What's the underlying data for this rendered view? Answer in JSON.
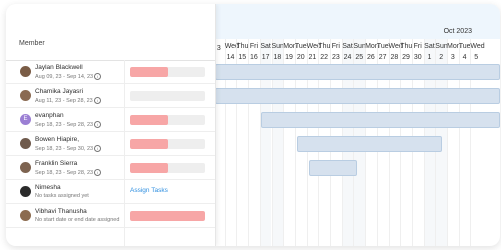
{
  "header": {
    "member_label": "Member"
  },
  "timeline": {
    "month_label": "Oct 2023",
    "days": [
      {
        "dow": "",
        "num": "3"
      },
      {
        "dow": "Wed",
        "num": "14"
      },
      {
        "dow": "Thu",
        "num": "15"
      },
      {
        "dow": "Fri",
        "num": "16"
      },
      {
        "dow": "Sat",
        "num": "17"
      },
      {
        "dow": "Sun",
        "num": "18"
      },
      {
        "dow": "Mon",
        "num": "19"
      },
      {
        "dow": "Tue",
        "num": "20"
      },
      {
        "dow": "Wed",
        "num": "21"
      },
      {
        "dow": "Thu",
        "num": "22"
      },
      {
        "dow": "Fri",
        "num": "23"
      },
      {
        "dow": "Sat",
        "num": "24"
      },
      {
        "dow": "Sun",
        "num": "25"
      },
      {
        "dow": "Mon",
        "num": "26"
      },
      {
        "dow": "Tue",
        "num": "27"
      },
      {
        "dow": "Wed",
        "num": "28"
      },
      {
        "dow": "Thu",
        "num": "29"
      },
      {
        "dow": "Fri",
        "num": "30"
      },
      {
        "dow": "Sat",
        "num": "1"
      },
      {
        "dow": "Sun",
        "num": "2"
      },
      {
        "dow": "Mon",
        "num": "3"
      },
      {
        "dow": "Tue",
        "num": "4"
      },
      {
        "dow": "Wed",
        "num": "5"
      }
    ]
  },
  "members": [
    {
      "name": "Jaylan Blackwell",
      "dates": "Aug 09, 23 - Sep 14, 23",
      "info_icon": "info-icon",
      "avatar_color": "#7a5c46",
      "progress": 0.5
    },
    {
      "name": "Chamika Jayasri",
      "dates": "Aug 11, 23 - Sep 28, 23",
      "info_icon": "info-icon",
      "avatar_color": "#8a6a52",
      "progress": 0.0
    },
    {
      "name": "evanphan",
      "dates": "Sep 18, 23 - Sep 28, 23",
      "info_icon": "info-icon",
      "avatar_color": "#9b7fd4",
      "avatar_letter": "E",
      "progress": 0.5
    },
    {
      "name": "Bowen Hiapire,",
      "dates": "Sep 18, 23 - Sep 30, 23",
      "info_icon": "info-icon",
      "avatar_color": "#6f5a4c",
      "progress": 0.5
    },
    {
      "name": "Franklin Sierra",
      "dates": "Sep 18, 23 - Sep 28, 23",
      "info_icon": "info-icon",
      "avatar_color": "#7d6350",
      "progress": 0.5
    },
    {
      "name": "Nimesha",
      "dates": "No tasks assigned yet",
      "avatar_color": "#2b2b2b",
      "assign_label": "Assign Tasks"
    },
    {
      "name": "Vibhavi Thanusha",
      "dates": "No start date or end date assigned",
      "avatar_color": "#8b6b4f",
      "progress": 1.0
    }
  ],
  "colors": {
    "accent": "#2f8fe0",
    "progress_fill": "#f7a6a6",
    "bar_fill": "#d6e1ee",
    "header_bg": "#eef6fd"
  }
}
